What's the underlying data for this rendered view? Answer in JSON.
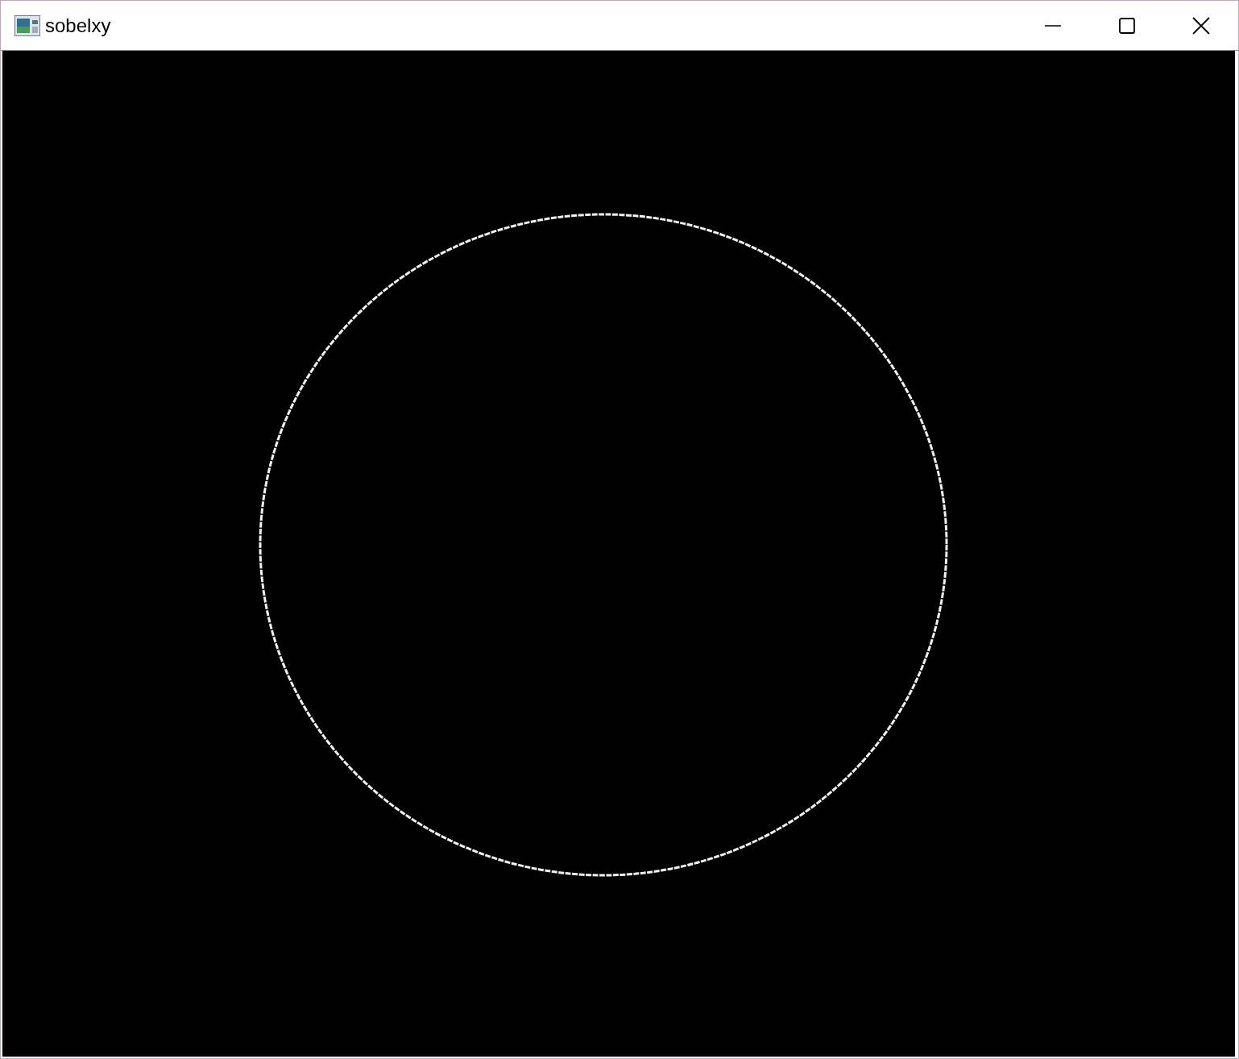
{
  "window": {
    "title": "sobelxy"
  }
}
